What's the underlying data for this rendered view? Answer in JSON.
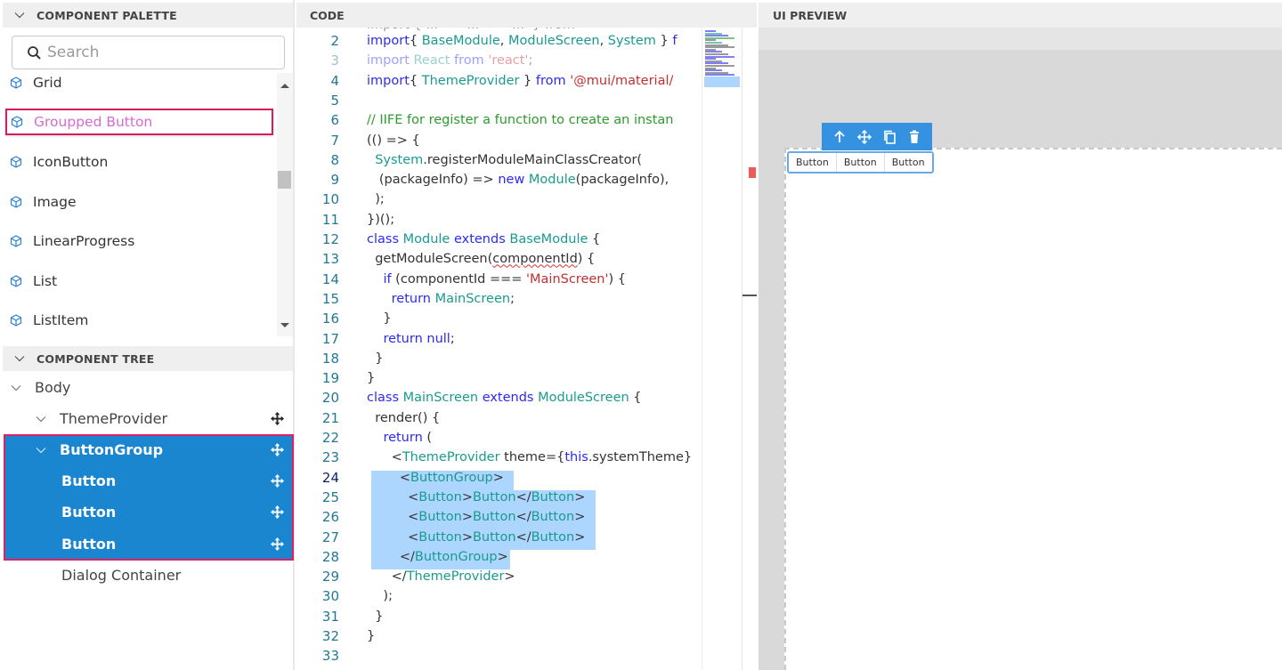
{
  "palette": {
    "title": "COMPONENT PALETTE",
    "search_placeholder": "Search",
    "items": [
      {
        "label": "Grid",
        "icon": "cube-icon"
      },
      {
        "label": "Groupped Button",
        "icon": "cube-icon",
        "highlighted": true
      },
      {
        "label": "IconButton",
        "icon": "cube-icon"
      },
      {
        "label": "Image",
        "icon": "cube-icon"
      },
      {
        "label": "LinearProgress",
        "icon": "cube-icon"
      },
      {
        "label": "List",
        "icon": "cube-icon"
      },
      {
        "label": "ListItem",
        "icon": "cube-icon"
      }
    ]
  },
  "tree": {
    "title": "COMPONENT TREE",
    "items": [
      {
        "label": "Body",
        "expanded": true
      },
      {
        "label": "ThemeProvider",
        "expanded": true
      },
      {
        "label": "ButtonGroup",
        "expanded": true,
        "selected": true
      },
      {
        "label": "Button",
        "selected": true
      },
      {
        "label": "Button",
        "selected": true
      },
      {
        "label": "Button",
        "selected": true
      },
      {
        "label": "Dialog Container"
      }
    ]
  },
  "code": {
    "title": "CODE",
    "active_line": 24,
    "lines": [
      {
        "n": "2",
        "parts": [
          [
            "kw",
            "import"
          ],
          [
            "",
            "{ "
          ],
          [
            "ty",
            "BaseModule"
          ],
          [
            "",
            ", "
          ],
          [
            "ty",
            "ModuleScreen"
          ],
          [
            "",
            ", "
          ],
          [
            "ty",
            "System"
          ],
          [
            "",
            " } "
          ],
          [
            "kw",
            "f"
          ]
        ]
      },
      {
        "n": "3",
        "faded": true,
        "parts": [
          [
            "kw",
            "import"
          ],
          [
            "",
            " "
          ],
          [
            "ty",
            "React"
          ],
          [
            "",
            " "
          ],
          [
            "kw",
            "from"
          ],
          [
            "",
            " "
          ],
          [
            "str",
            "'react'"
          ],
          [
            "",
            ";"
          ]
        ]
      },
      {
        "n": "4",
        "parts": [
          [
            "kw",
            "import"
          ],
          [
            "",
            "{ "
          ],
          [
            "ty",
            "ThemeProvider"
          ],
          [
            "",
            " } "
          ],
          [
            "kw",
            "from"
          ],
          [
            "",
            " "
          ],
          [
            "str",
            "'@mui/material/"
          ]
        ]
      },
      {
        "n": "5",
        "parts": []
      },
      {
        "n": "6",
        "parts": [
          [
            "cm",
            "// IIFE for register a function to create an instan"
          ]
        ]
      },
      {
        "n": "7",
        "parts": [
          [
            "",
            "(() => {"
          ]
        ]
      },
      {
        "n": "8",
        "parts": [
          [
            "",
            "  "
          ],
          [
            "ty",
            "System"
          ],
          [
            "",
            ".registerModuleMainClassCreator("
          ]
        ]
      },
      {
        "n": "9",
        "parts": [
          [
            "",
            "   (packageInfo) => "
          ],
          [
            "kw",
            "new"
          ],
          [
            "",
            " "
          ],
          [
            "ty",
            "Module"
          ],
          [
            "",
            "(packageInfo),"
          ]
        ]
      },
      {
        "n": "10",
        "parts": [
          [
            "",
            "  );"
          ]
        ]
      },
      {
        "n": "11",
        "parts": [
          [
            "",
            "})();"
          ]
        ]
      },
      {
        "n": "12",
        "parts": [
          [
            "kw",
            "class"
          ],
          [
            "",
            " "
          ],
          [
            "ty",
            "Module"
          ],
          [
            "",
            " "
          ],
          [
            "kw",
            "extends"
          ],
          [
            "",
            " "
          ],
          [
            "ty",
            "BaseModule"
          ],
          [
            "",
            " {"
          ]
        ]
      },
      {
        "n": "13",
        "parts": [
          [
            "",
            "  getModuleScreen("
          ],
          [
            "squiggle",
            "componentId"
          ],
          [
            "",
            ") {"
          ]
        ]
      },
      {
        "n": "14",
        "parts": [
          [
            "",
            "    "
          ],
          [
            "kw",
            "if"
          ],
          [
            "",
            " (componentId === "
          ],
          [
            "str",
            "'MainScreen'"
          ],
          [
            "",
            ") {"
          ]
        ]
      },
      {
        "n": "15",
        "parts": [
          [
            "",
            "      "
          ],
          [
            "kw",
            "return"
          ],
          [
            "",
            " "
          ],
          [
            "ty",
            "MainScreen"
          ],
          [
            "",
            ";"
          ]
        ]
      },
      {
        "n": "16",
        "parts": [
          [
            "",
            "    }"
          ]
        ]
      },
      {
        "n": "17",
        "parts": [
          [
            "",
            "    "
          ],
          [
            "kw",
            "return"
          ],
          [
            "",
            " "
          ],
          [
            "kw",
            "null"
          ],
          [
            "",
            ";"
          ]
        ]
      },
      {
        "n": "18",
        "parts": [
          [
            "",
            "  }"
          ]
        ]
      },
      {
        "n": "19",
        "parts": [
          [
            "",
            "}"
          ]
        ]
      },
      {
        "n": "20",
        "parts": [
          [
            "kw",
            "class"
          ],
          [
            "",
            " "
          ],
          [
            "ty",
            "MainScreen"
          ],
          [
            "",
            " "
          ],
          [
            "kw",
            "extends"
          ],
          [
            "",
            " "
          ],
          [
            "ty",
            "ModuleScreen"
          ],
          [
            "",
            " {"
          ]
        ]
      },
      {
        "n": "21",
        "parts": [
          [
            "",
            "  render() {"
          ]
        ]
      },
      {
        "n": "22",
        "parts": [
          [
            "",
            "    "
          ],
          [
            "kw",
            "return"
          ],
          [
            "",
            " ("
          ]
        ]
      },
      {
        "n": "23",
        "parts": [
          [
            "",
            "      <"
          ],
          [
            "ty",
            "ThemeProvider"
          ],
          [
            "",
            " theme={"
          ],
          [
            "kw",
            "this"
          ],
          [
            "",
            ".systemTheme}"
          ]
        ]
      },
      {
        "n": "24",
        "parts": [
          [
            "",
            "        <"
          ],
          [
            "ty",
            "ButtonGroup"
          ],
          [
            "",
            ">"
          ]
        ]
      },
      {
        "n": "25",
        "parts": [
          [
            "",
            "          <"
          ],
          [
            "ty",
            "Button"
          ],
          [
            "",
            ">"
          ],
          [
            "ty",
            "Button"
          ],
          [
            "",
            "</"
          ],
          [
            "ty",
            "Button"
          ],
          [
            "",
            ">"
          ]
        ]
      },
      {
        "n": "26",
        "parts": [
          [
            "",
            "          <"
          ],
          [
            "ty",
            "Button"
          ],
          [
            "",
            ">"
          ],
          [
            "ty",
            "Button"
          ],
          [
            "",
            "</"
          ],
          [
            "ty",
            "Button"
          ],
          [
            "",
            ">"
          ]
        ]
      },
      {
        "n": "27",
        "parts": [
          [
            "",
            "          <"
          ],
          [
            "ty",
            "Button"
          ],
          [
            "",
            ">"
          ],
          [
            "ty",
            "Button"
          ],
          [
            "",
            "</"
          ],
          [
            "ty",
            "Button"
          ],
          [
            "",
            ">"
          ]
        ]
      },
      {
        "n": "28",
        "parts": [
          [
            "",
            "        </"
          ],
          [
            "ty",
            "ButtonGroup"
          ],
          [
            "",
            ">"
          ]
        ]
      },
      {
        "n": "29",
        "parts": [
          [
            "",
            "      </"
          ],
          [
            "ty",
            "ThemeProvider"
          ],
          [
            "",
            ">"
          ]
        ]
      },
      {
        "n": "30",
        "parts": [
          [
            "",
            "    );"
          ]
        ]
      },
      {
        "n": "31",
        "parts": [
          [
            "",
            "  }"
          ]
        ]
      },
      {
        "n": "32",
        "parts": [
          [
            "",
            "}"
          ]
        ]
      },
      {
        "n": "33",
        "parts": []
      }
    ]
  },
  "preview": {
    "title": "UI PREVIEW",
    "toolbar": [
      "arrow-up-icon",
      "move-icon",
      "copy-icon",
      "delete-icon"
    ],
    "buttons": [
      "Button",
      "Button",
      "Button"
    ]
  },
  "colors": {
    "accent": "#1a86d0",
    "highlight_border": "#e01f65",
    "toolbar": "#3592e0",
    "selection": "#add6ff"
  }
}
